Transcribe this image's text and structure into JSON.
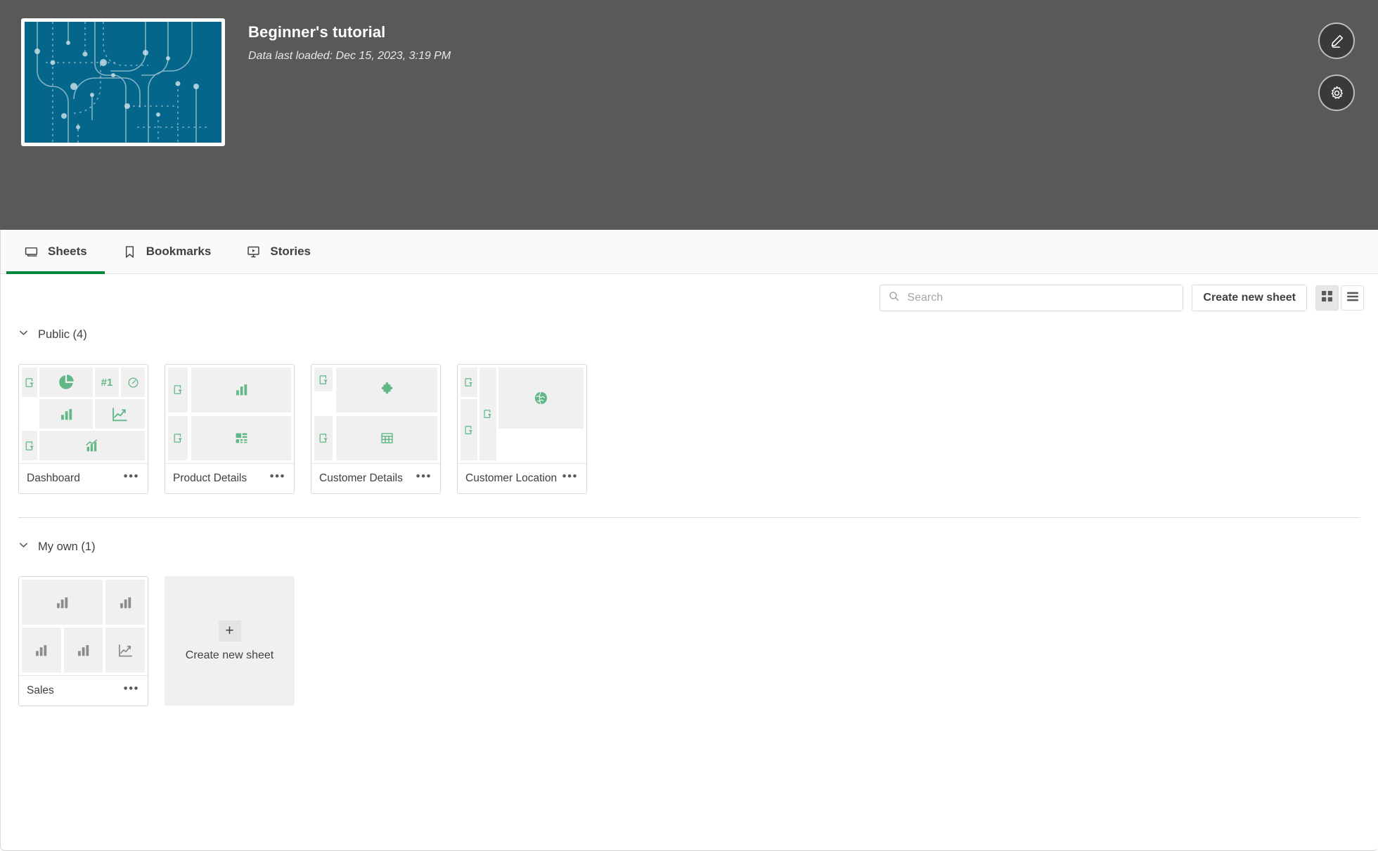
{
  "header": {
    "app_title": "Beginner's tutorial",
    "data_last_loaded": "Data last loaded: Dec 15, 2023, 3:19 PM",
    "thumbnail_color": "#04668a",
    "background_color": "#595959",
    "edit_button_label": "Edit",
    "settings_button_label": "App options"
  },
  "tabs": [
    {
      "label": "Sheets",
      "icon": "sheet-icon",
      "active": true
    },
    {
      "label": "Bookmarks",
      "icon": "bookmark-icon",
      "active": false
    },
    {
      "label": "Stories",
      "icon": "story-icon",
      "active": false
    }
  ],
  "toolbar": {
    "search_placeholder": "Search",
    "search_value": "",
    "create_sheet_label": "Create new sheet",
    "grid_view_selected": true,
    "list_view_selected": false
  },
  "accent_color": "#00873d",
  "icon_green": "#61b786",
  "sections": [
    {
      "id": "public",
      "title": "Public (4)",
      "expanded": true,
      "sheets": [
        {
          "name": "Dashboard",
          "menu_label": "•••",
          "icon_color": "#61b786",
          "layout": "thumb-dashboard",
          "tiles": [
            {
              "icon": "filter-icon",
              "col": "1",
              "row": "1"
            },
            {
              "icon": "pie-chart-icon",
              "col": "2",
              "row": "1 / span 1"
            },
            {
              "icon": "kpi-number-icon",
              "col": "3",
              "row": "1"
            },
            {
              "icon": "gauge-icon",
              "col": "4",
              "row": "1"
            },
            {
              "icon": "bar-chart-icon",
              "col": "2",
              "row": "2"
            },
            {
              "icon": "line-chart-icon",
              "col": "3 / span 2",
              "row": "2"
            },
            {
              "icon": "filter-icon",
              "col": "1",
              "row": "3"
            },
            {
              "icon": "combo-chart-icon",
              "col": "2 / span 3",
              "row": "3"
            }
          ]
        },
        {
          "name": "Product Details",
          "menu_label": "•••",
          "icon_color": "#61b786",
          "layout": "thumb-product",
          "tiles": [
            {
              "icon": "filter-icon",
              "col": "1",
              "row": "1"
            },
            {
              "icon": "bar-chart-icon",
              "col": "2",
              "row": "1"
            },
            {
              "icon": "filter-icon",
              "col": "1",
              "row": "2"
            },
            {
              "icon": "treemap-icon",
              "col": "2",
              "row": "2"
            }
          ]
        },
        {
          "name": "Customer Details",
          "menu_label": "•••",
          "icon_color": "#61b786",
          "layout": "thumb-customer",
          "tiles": [
            {
              "icon": "filter-icon",
              "col": "1",
              "row": "1"
            },
            {
              "icon": "puzzle-icon",
              "col": "2",
              "row": "1"
            },
            {
              "icon": "filter-icon",
              "col": "1",
              "row": "2"
            },
            {
              "icon": "table-icon",
              "col": "2",
              "row": "2"
            }
          ]
        },
        {
          "name": "Customer Location",
          "menu_label": "•••",
          "icon_color": "#61b786",
          "layout": "thumb-location",
          "tiles": [
            {
              "icon": "filter-icon",
              "col": "1",
              "row": "1"
            },
            {
              "icon": "filter-icon",
              "col": "1",
              "row": "2 / span 2"
            },
            {
              "icon": "filter-icon",
              "col": "2",
              "row": "1 / span 3"
            },
            {
              "icon": "map-globe-icon",
              "col": "3",
              "row": "1 / span 2"
            }
          ]
        }
      ]
    },
    {
      "id": "my-own",
      "title": "My own (1)",
      "expanded": true,
      "sheets": [
        {
          "name": "Sales",
          "menu_label": "•••",
          "icon_color": "#8c8c8c",
          "layout": "thumb-sales",
          "tiles": [
            {
              "icon": "bar-chart-icon",
              "col": "1 / span 2",
              "row": "1"
            },
            {
              "icon": "bar-chart-icon",
              "col": "3",
              "row": "1"
            },
            {
              "icon": "bar-chart-icon",
              "col": "1",
              "row": "2"
            },
            {
              "icon": "bar-chart-icon",
              "col": "2",
              "row": "2"
            },
            {
              "icon": "line-chart-icon",
              "col": "3",
              "row": "2"
            }
          ]
        }
      ],
      "create_tile": {
        "label": "Create new sheet",
        "plus": "+"
      }
    }
  ]
}
